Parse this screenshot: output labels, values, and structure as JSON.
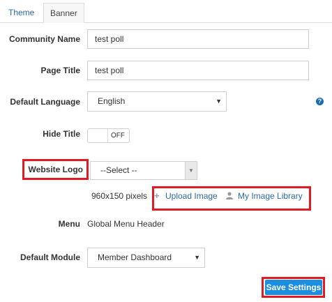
{
  "tabs": [
    {
      "label": "Theme"
    },
    {
      "label": "Banner"
    }
  ],
  "form": {
    "community_name": {
      "label": "Community Name",
      "value": "test poll"
    },
    "page_title": {
      "label": "Page Title",
      "value": "test poll"
    },
    "default_language": {
      "label": "Default Language",
      "value": "English"
    },
    "hide_title": {
      "label": "Hide Title",
      "state": "OFF"
    },
    "website_logo": {
      "label": "Website Logo",
      "value": "--Select --",
      "dimensions": "960x150 pixels",
      "upload_label": "Upload Image",
      "library_label": "My Image Library"
    },
    "menu": {
      "label": "Menu",
      "value": "Global Menu Header"
    },
    "default_module": {
      "label": "Default Module",
      "value": "Member Dashboard"
    }
  },
  "save_label": "Save Settings",
  "icons": {
    "help": "question-circle-icon",
    "plus": "plus-icon",
    "user": "user-icon"
  },
  "colors": {
    "accent": "#1b8ee0",
    "highlight": "#e01b24",
    "link": "#2a6aa6"
  }
}
